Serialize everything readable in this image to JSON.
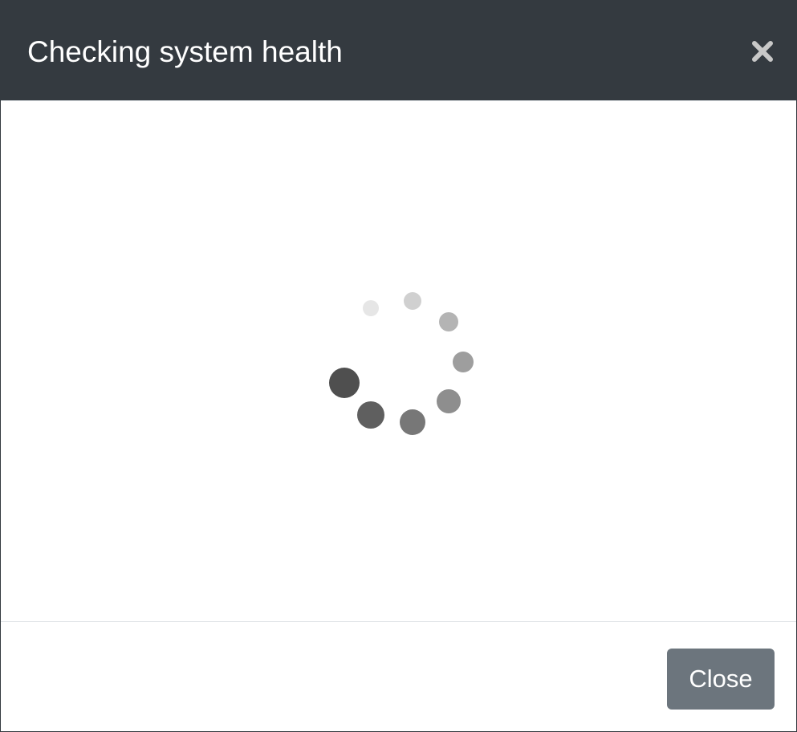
{
  "modal": {
    "title": "Checking system health",
    "close_icon": "close-x-icon",
    "close_button_label": "Close",
    "loading_indicator": "spinner-dots-icon"
  },
  "colors": {
    "header_bg": "#343a40",
    "title_text": "#ffffff",
    "close_icon": "#c8c8c8",
    "button_bg": "#6c757d",
    "button_text": "#ffffff",
    "divider": "#dee2e6"
  }
}
